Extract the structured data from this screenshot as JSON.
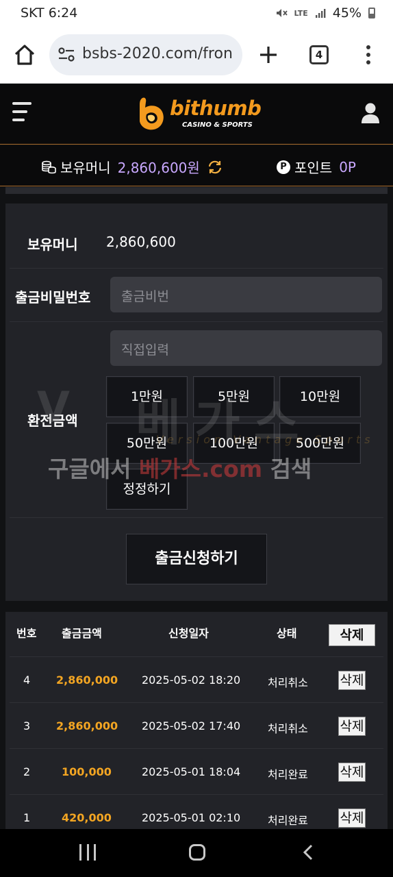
{
  "status_bar": {
    "time": "SKT 6:24",
    "network": "LTE",
    "battery": "45%"
  },
  "browser": {
    "url": "bsbs-2020.com/fron",
    "tab_count": "4"
  },
  "header": {
    "logo_text": "bithumb",
    "logo_sub": "CASINO & SPORTS"
  },
  "money_bar": {
    "money_label": "보유머니",
    "money_value": "2,860,600원",
    "point_badge": "P",
    "point_label": "포인트",
    "point_value": "0P"
  },
  "form": {
    "balance_label": "보유머니",
    "balance_value": "2,860,600",
    "password_label": "출금비밀번호",
    "password_placeholder": "출금비번",
    "amount_label": "환전금액",
    "amount_placeholder": "직접입력",
    "amount_buttons": [
      "1만원",
      "5만원",
      "10만원",
      "50만원",
      "100만원",
      "500만원"
    ],
    "reset_label": "정정하기",
    "submit_label": "출금신청하기"
  },
  "watermark": {
    "brand": "베가스",
    "sub": "Version  Vantage  Sports",
    "line_prefix": "구글에서 ",
    "line_highlight": "베가스.com",
    "line_suffix": " 검색"
  },
  "history": {
    "columns": [
      "번호",
      "출금금액",
      "신청일자",
      "상태"
    ],
    "delete_all_label": "삭제",
    "rows": [
      {
        "no": "4",
        "amount": "2,860,000",
        "date": "2025-05-02 18:20",
        "status": "처리취소",
        "delete": "삭제"
      },
      {
        "no": "3",
        "amount": "2,860,000",
        "date": "2025-05-02 17:40",
        "status": "처리취소",
        "delete": "삭제"
      },
      {
        "no": "2",
        "amount": "100,000",
        "date": "2025-05-01 18:04",
        "status": "처리완료",
        "delete": "삭제"
      },
      {
        "no": "1",
        "amount": "420,000",
        "date": "2025-05-01 02:10",
        "status": "처리완료",
        "delete": "삭제"
      }
    ]
  },
  "colors": {
    "accent_orange": "#f39a1e",
    "money_purple": "#c9a8ff",
    "amount_orange": "#f3a522"
  },
  "icons": {
    "status": [
      "mute-icon",
      "signal-icon",
      "battery-icon"
    ],
    "browser": [
      "home-icon",
      "site-settings-icon",
      "plus-icon",
      "tabs-icon",
      "more-icon"
    ],
    "header": [
      "menu-icon",
      "user-icon"
    ],
    "money": [
      "coins-icon",
      "refresh-icon",
      "point-icon"
    ],
    "nav": [
      "recent-apps-icon",
      "home-nav-icon",
      "back-icon"
    ]
  }
}
